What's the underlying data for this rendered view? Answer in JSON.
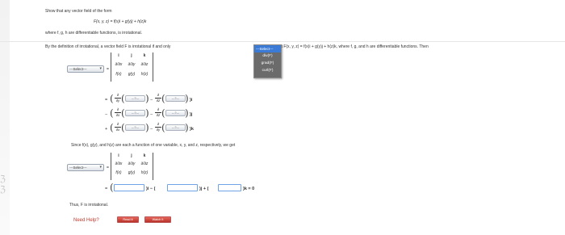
{
  "prompt": {
    "line1": "Show that any vector field of the form",
    "line2": "F(x, y, z) = f(x)i + g(y)j + h(z)k",
    "line3": "where f, g, h are differentiable functions, is irrotational.",
    "line4a": "By the definition of irrotational, a vector field F is irrotational if and only",
    "line4b": "Let F(x, y, z) = f(x)i + g(y)j + h(z)k, where f, g, and h are differentiable functions. Then"
  },
  "dropdown1": {
    "value": "---Select---",
    "options": [
      "---Select---",
      "div(F)",
      "grad(F)",
      "curl(F)"
    ]
  },
  "dropdown2": {
    "value": "---Select---"
  },
  "dropdown_top": {
    "value": "---Select---"
  },
  "matrix": {
    "r1": [
      "i",
      "j",
      "k"
    ],
    "r2": [
      "∂/∂x",
      "∂/∂y",
      "∂/∂z"
    ],
    "r3": [
      "f(x)",
      "g(y)",
      "h(z)"
    ]
  },
  "expansion": {
    "row1_lead": "=",
    "row1_tail": ")i",
    "row2_lead": "−",
    "row2_tail": ")j",
    "row3_lead": "+",
    "row3_tail": ")k",
    "partial_y": "∂/∂y",
    "partial_z": "∂/∂z",
    "partial_x": "∂/∂x",
    "mini_sel": "---?---"
  },
  "since": "Since f(x), g(y), and h(z) are each a function of one variable, x, y, and z, respectively, we get",
  "final_row": {
    "eq": "=",
    "i": ")i − (",
    "j": ")j + (",
    "k": ")k = 0"
  },
  "thus": "Thus, F is irrotational.",
  "help": {
    "label": "Need Help?",
    "read": "Read It",
    "watch": "Watch It"
  }
}
